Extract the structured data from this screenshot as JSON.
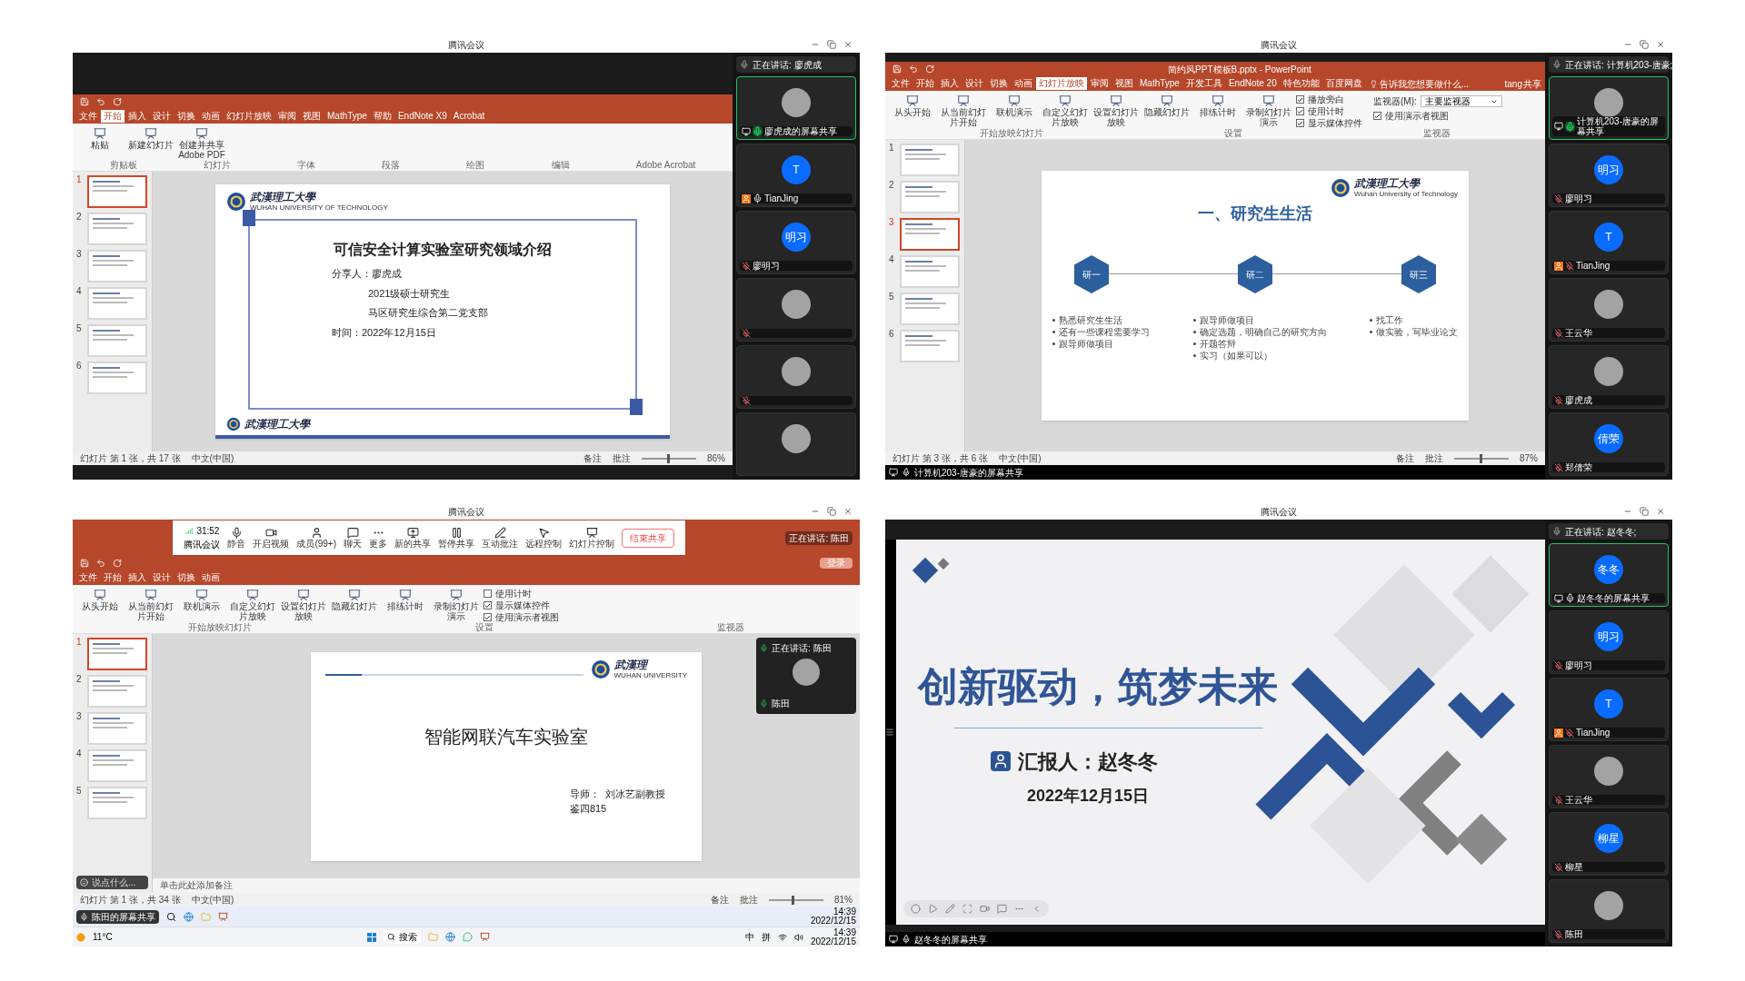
{
  "panels": [
    {
      "kind": "ppt_window",
      "window_title": "腾讯会议",
      "speaking": "正在讲话: 廖虎成",
      "ppt": {
        "tabs": [
          {
            "label": "文件",
            "selected": false
          },
          {
            "label": "开始",
            "selected": true
          },
          {
            "label": "插入",
            "selected": false
          },
          {
            "label": "设计",
            "selected": false
          },
          {
            "label": "切换",
            "selected": false
          },
          {
            "label": "动画",
            "selected": false
          },
          {
            "label": "幻灯片放映",
            "selected": false
          },
          {
            "label": "审阅",
            "selected": false
          },
          {
            "label": "视图",
            "selected": false
          },
          {
            "label": "MathType",
            "selected": false
          },
          {
            "label": "帮助",
            "selected": false
          },
          {
            "label": "EndNote X9",
            "selected": false
          },
          {
            "label": "Acrobat",
            "selected": false
          }
        ],
        "ribbon": {
          "items": [
            {
              "kind": "button",
              "label": "粘贴"
            },
            {
              "kind": "button",
              "label": "新建幻灯片"
            },
            {
              "kind": "button",
              "label": "创建并共享 Adobe PDF"
            }
          ],
          "groups": [
            "剪贴板",
            "幻灯片",
            "字体",
            "段落",
            "绘图",
            "编辑",
            "Adobe Acrobat"
          ]
        },
        "thumbnails": [
          {
            "number": "1",
            "selected": true
          },
          {
            "number": "2",
            "selected": false
          },
          {
            "number": "3",
            "selected": false
          },
          {
            "number": "4",
            "selected": false
          },
          {
            "number": "5",
            "selected": false
          },
          {
            "number": "6",
            "selected": false
          }
        ],
        "status": {
          "left": [
            "幻灯片 第 1 张，共 17 张",
            "中文(中国)"
          ],
          "right": [
            "备注",
            "批注"
          ],
          "zoom": "86%",
          "level": 0.5
        },
        "slide": {
          "kind": "cover",
          "logo": "武漢理工大學",
          "logo_sub": "WUHAN UNIVERSITY OF TECHNOLOGY",
          "title": "可信安全计算实验室研究领域介绍",
          "lines": [
            "分享人：廖虎成",
            "2021级硕士研究生",
            "马区研究生综合第二党支部",
            "时间：2022年12月15日"
          ],
          "footer_logo": "武漢理工大學"
        }
      },
      "participants": [
        {
          "kind": "photo",
          "name": "廖虎成的屏幕共享",
          "muted": false,
          "speaking": true,
          "sharing": true,
          "host": false
        },
        {
          "kind": "initials",
          "initials": "T",
          "name": "TianJing",
          "muted": false,
          "speaking": false,
          "sharing": false,
          "host": true
        },
        {
          "kind": "initials",
          "initials": "明习",
          "name": "廖明习",
          "muted": true,
          "sharing": false,
          "host": false
        },
        {
          "kind": "photo",
          "muted": true,
          "sharing": false,
          "host": false
        },
        {
          "kind": "photo",
          "muted": true,
          "sharing": false,
          "host": false
        },
        {
          "kind": "photo",
          "sharing": false
        }
      ]
    },
    {
      "kind": "ppt_full",
      "window_title": "腾讯会议",
      "speaking": "正在讲话: 计算机203-唐豪;",
      "share_label": "计算机203-唐豪的屏幕共享",
      "ppt": {
        "title": "简约风PPT模板B.pptx - PowerPoint",
        "tell_me": "告诉我您想要做什么...",
        "user": "tang",
        "share": "共享",
        "tabs": [
          {
            "label": "文件",
            "selected": false
          },
          {
            "label": "开始",
            "selected": false
          },
          {
            "label": "插入",
            "selected": false
          },
          {
            "label": "设计",
            "selected": false
          },
          {
            "label": "切换",
            "selected": false
          },
          {
            "label": "动画",
            "selected": false
          },
          {
            "label": "幻灯片放映",
            "selected": true
          },
          {
            "label": "审阅",
            "selected": false
          },
          {
            "label": "视图",
            "selected": false
          },
          {
            "label": "MathType",
            "selected": false
          },
          {
            "label": "开发工具",
            "selected": false
          },
          {
            "label": "EndNote 20",
            "selected": false
          },
          {
            "label": "特色功能",
            "selected": false
          },
          {
            "label": "百度网盘",
            "selected": false
          }
        ],
        "ribbon": {
          "items": [
            {
              "kind": "button",
              "label": "从头开始"
            },
            {
              "kind": "button",
              "label": "从当前幻灯片开始"
            },
            {
              "kind": "button",
              "label": "联机演示"
            },
            {
              "kind": "button",
              "label": "自定义幻灯片放映"
            },
            {
              "kind": "button",
              "label": "设置幻灯片放映"
            },
            {
              "kind": "button",
              "label": "隐藏幻灯片"
            },
            {
              "kind": "button",
              "label": "排练计时"
            },
            {
              "kind": "button",
              "label": "录制幻灯片演示"
            },
            {
              "kind": "check",
              "label": "播放旁白",
              "checked": true
            },
            {
              "kind": "check",
              "label": "使用计时",
              "checked": true
            },
            {
              "kind": "check",
              "label": "显示媒体控件",
              "checked": true
            }
          ],
          "groups": [
            "开始放映幻灯片",
            "设置",
            "监视器"
          ],
          "monitor": {
            "label": "监视器(M):",
            "value": "主要监视器",
            "presenter_view": {
              "label": "使用演示者视图",
              "checked": true
            }
          }
        },
        "thumbnails": [
          {
            "number": "1",
            "selected": false
          },
          {
            "number": "2",
            "selected": false
          },
          {
            "number": "3",
            "selected": true
          },
          {
            "number": "4",
            "selected": false
          },
          {
            "number": "5",
            "selected": false
          },
          {
            "number": "6",
            "selected": false
          }
        ],
        "status": {
          "left": [
            "幻灯片 第 3 张，共 6 张",
            "中文(中国)"
          ],
          "right": [
            "备注",
            "批注"
          ],
          "zoom": "87%",
          "level": 0.5
        },
        "slide": {
          "kind": "timeline",
          "logo": "武漢理工大學",
          "logo_sub": "Wuhan University of Technology",
          "title": "一、研究生生活",
          "stages": [
            {
              "label": "研一",
              "bullets": [
                "熟悉研究生生活",
                "还有一些课程需要学习",
                "跟导师做项目"
              ]
            },
            {
              "label": "研二",
              "bullets": [
                "跟导师做项目",
                "确定选题，明确自己的研究方向",
                "开题答辩",
                "实习（如果可以）"
              ]
            },
            {
              "label": "研三",
              "bullets": [
                "找工作",
                "做实验，写毕业论文"
              ]
            }
          ]
        }
      },
      "participants": [
        {
          "kind": "photo",
          "name": "计算机203-唐豪的屏幕共享",
          "muted": false,
          "speaking": true,
          "sharing": true,
          "host": false
        },
        {
          "kind": "initials",
          "initials": "明习",
          "name": "廖明习",
          "muted": true,
          "sharing": false,
          "host": false
        },
        {
          "kind": "initials",
          "initials": "T",
          "name": "TianJing",
          "muted": true,
          "sharing": false,
          "host": true
        },
        {
          "kind": "photo",
          "name": "王云华",
          "muted": true,
          "sharing": false,
          "host": false
        },
        {
          "kind": "photo",
          "name": "廖虎成",
          "muted": true,
          "sharing": false,
          "host": false
        },
        {
          "kind": "initials",
          "initials": "倩荣",
          "name": "郑倩荣",
          "muted": true,
          "sharing": false,
          "host": false
        }
      ]
    },
    {
      "kind": "ppt_desktop",
      "window_title": "腾讯会议",
      "speaking": "正在讲话: 陈田",
      "share_label": "陈田的屏幕共享",
      "toolbar": {
        "timer": "31:52",
        "app": "腾讯会议",
        "buttons": [
          "静音",
          "开启视频",
          "成员(99+)",
          "聊天",
          "更多",
          "新的共享",
          "暂停共享",
          "互动批注",
          "远程控制",
          "幻灯片控制"
        ],
        "end": "结束共享"
      },
      "camera": {
        "speaking": "正在讲话: 陈田",
        "name": "陈田"
      },
      "ppt": {
        "login": "登录",
        "chat": "说点什么...",
        "notes": "单击此处添加备注",
        "tabs": [
          {
            "label": "文件",
            "selected": false
          },
          {
            "label": "开始",
            "selected": false
          },
          {
            "label": "插入",
            "selected": false
          },
          {
            "label": "设计",
            "selected": false
          },
          {
            "label": "切换",
            "selected": false
          },
          {
            "label": "动画",
            "selected": false
          }
        ],
        "ribbon": {
          "items": [
            {
              "kind": "button",
              "label": "从头开始"
            },
            {
              "kind": "button",
              "label": "从当前幻灯片开始"
            },
            {
              "kind": "button",
              "label": "联机演示"
            },
            {
              "kind": "button",
              "label": "自定义幻灯片放映"
            },
            {
              "kind": "button",
              "label": "设置幻灯片放映"
            },
            {
              "kind": "button",
              "label": "隐藏幻灯片"
            },
            {
              "kind": "button",
              "label": "排练计时"
            },
            {
              "kind": "button",
              "label": "录制幻灯片演示"
            },
            {
              "kind": "check",
              "label": "使用计时",
              "checked": false
            },
            {
              "kind": "check",
              "label": "显示媒体控件",
              "checked": true
            },
            {
              "kind": "check",
              "label": "使用演示者视图",
              "checked": true
            }
          ],
          "groups": [
            "开始放映幻灯片",
            "设置",
            "监视器"
          ]
        },
        "thumbnails": [
          {
            "number": "1",
            "selected": true
          },
          {
            "number": "2",
            "selected": false
          },
          {
            "number": "3",
            "selected": false
          },
          {
            "number": "4",
            "selected": false
          },
          {
            "number": "5",
            "selected": false
          }
        ],
        "status": {
          "left": [
            "幻灯片 第 1 张，共 34 张",
            "中文(中国)"
          ],
          "right": [
            "备注",
            "批注"
          ],
          "zoom": "81%",
          "level": 0.45
        },
        "slide": {
          "kind": "title",
          "logo": "武漢理",
          "logo_sub": "WUHAN UNIVERSITY",
          "title": "智能网联汽车实验室",
          "lines": [
            "导师：  刘冰艺副教授",
            "鉴四815"
          ]
        }
      },
      "inner_taskbar": {
        "time": "14:39",
        "date": "2022/12/15"
      },
      "outer_taskbar": {
        "weather": "11°C",
        "search": "搜索",
        "ime": [
          "中",
          "拼"
        ],
        "time": "14:39",
        "date": "2022/12/15"
      }
    },
    {
      "kind": "slideshow",
      "window_title": "腾讯会议",
      "speaking": "正在讲话: 赵冬冬;",
      "share_label": "赵冬冬的屏幕共享",
      "slide": {
        "kind": "hero",
        "title": "创新驱动，筑梦未来",
        "presenter": "汇报人：赵冬冬",
        "date": "2022年12月15日"
      },
      "participants": [
        {
          "kind": "initials",
          "initials": "冬冬",
          "name": "赵冬冬的屏幕共享",
          "muted": false,
          "speaking": false,
          "sharing": true,
          "host": false
        },
        {
          "kind": "initials",
          "initials": "明习",
          "name": "廖明习",
          "muted": true,
          "sharing": false,
          "host": false
        },
        {
          "kind": "initials",
          "initials": "T",
          "name": "TianJing",
          "muted": true,
          "sharing": false,
          "host": true
        },
        {
          "kind": "photo",
          "name": "王云华",
          "muted": true,
          "sharing": false,
          "host": false
        },
        {
          "kind": "initials",
          "initials": "柳星",
          "name": "柳星",
          "muted": true,
          "sharing": false,
          "host": false
        },
        {
          "kind": "photo",
          "name": "陈田",
          "muted": true,
          "sharing": false,
          "host": false
        }
      ]
    }
  ]
}
